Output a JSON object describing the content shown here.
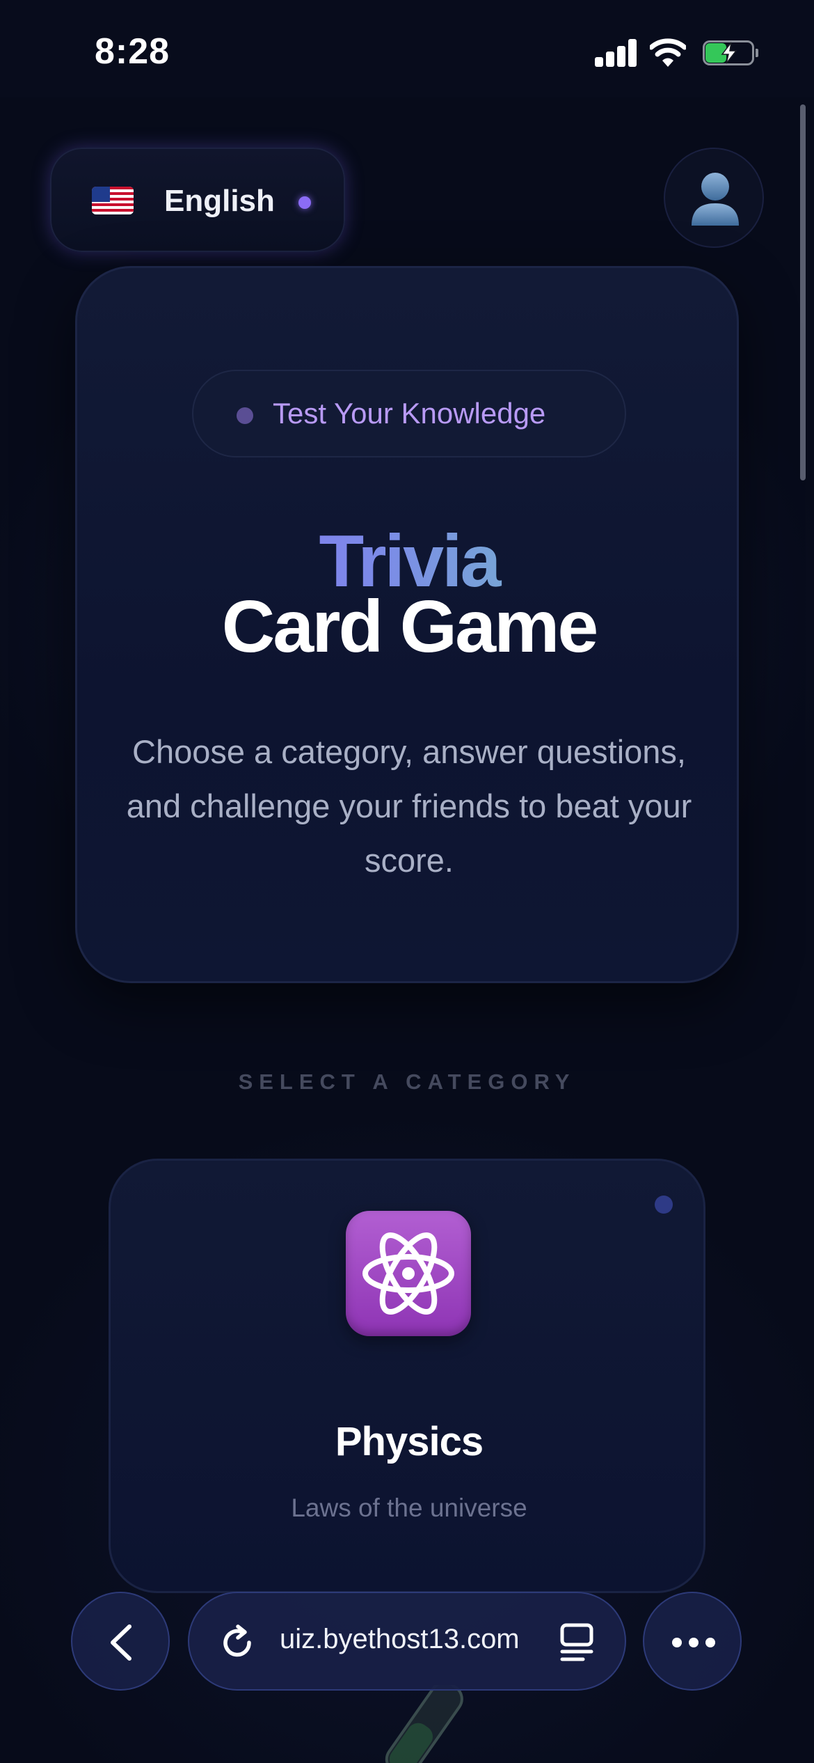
{
  "status_bar": {
    "time": "8:28",
    "icons": [
      "signal-icon",
      "wifi-icon",
      "battery-charging-icon"
    ]
  },
  "header": {
    "language": {
      "flag": "us-flag-icon",
      "label": "English"
    },
    "profile_icon": "person-silhouette-icon"
  },
  "hero": {
    "badge": "Test Your Knowledge",
    "title_line1": "Trivia",
    "title_line2": "Card Game",
    "description": "Choose a category, answer questions, and challenge your friends to beat your score.",
    "gradient_colors": [
      "#8b6cf6",
      "#7c8ae8",
      "#6fd6b6"
    ]
  },
  "categories_section": {
    "heading": "SELECT A CATEGORY",
    "items": [
      {
        "icon": "atom-icon",
        "name": "Physics",
        "description": "Laws of the universe",
        "icon_color": "#9b40c0"
      }
    ]
  },
  "browser": {
    "url": "uiz.byethost13.com",
    "back_icon": "chevron-left-icon",
    "reload_icon": "reload-icon",
    "tabs_icon": "tabs-icon",
    "more_icon": "more-dots-icon"
  },
  "colors": {
    "background": "#070b1a",
    "accent": "#8b6cf6",
    "badge_text": "#b89af5"
  }
}
